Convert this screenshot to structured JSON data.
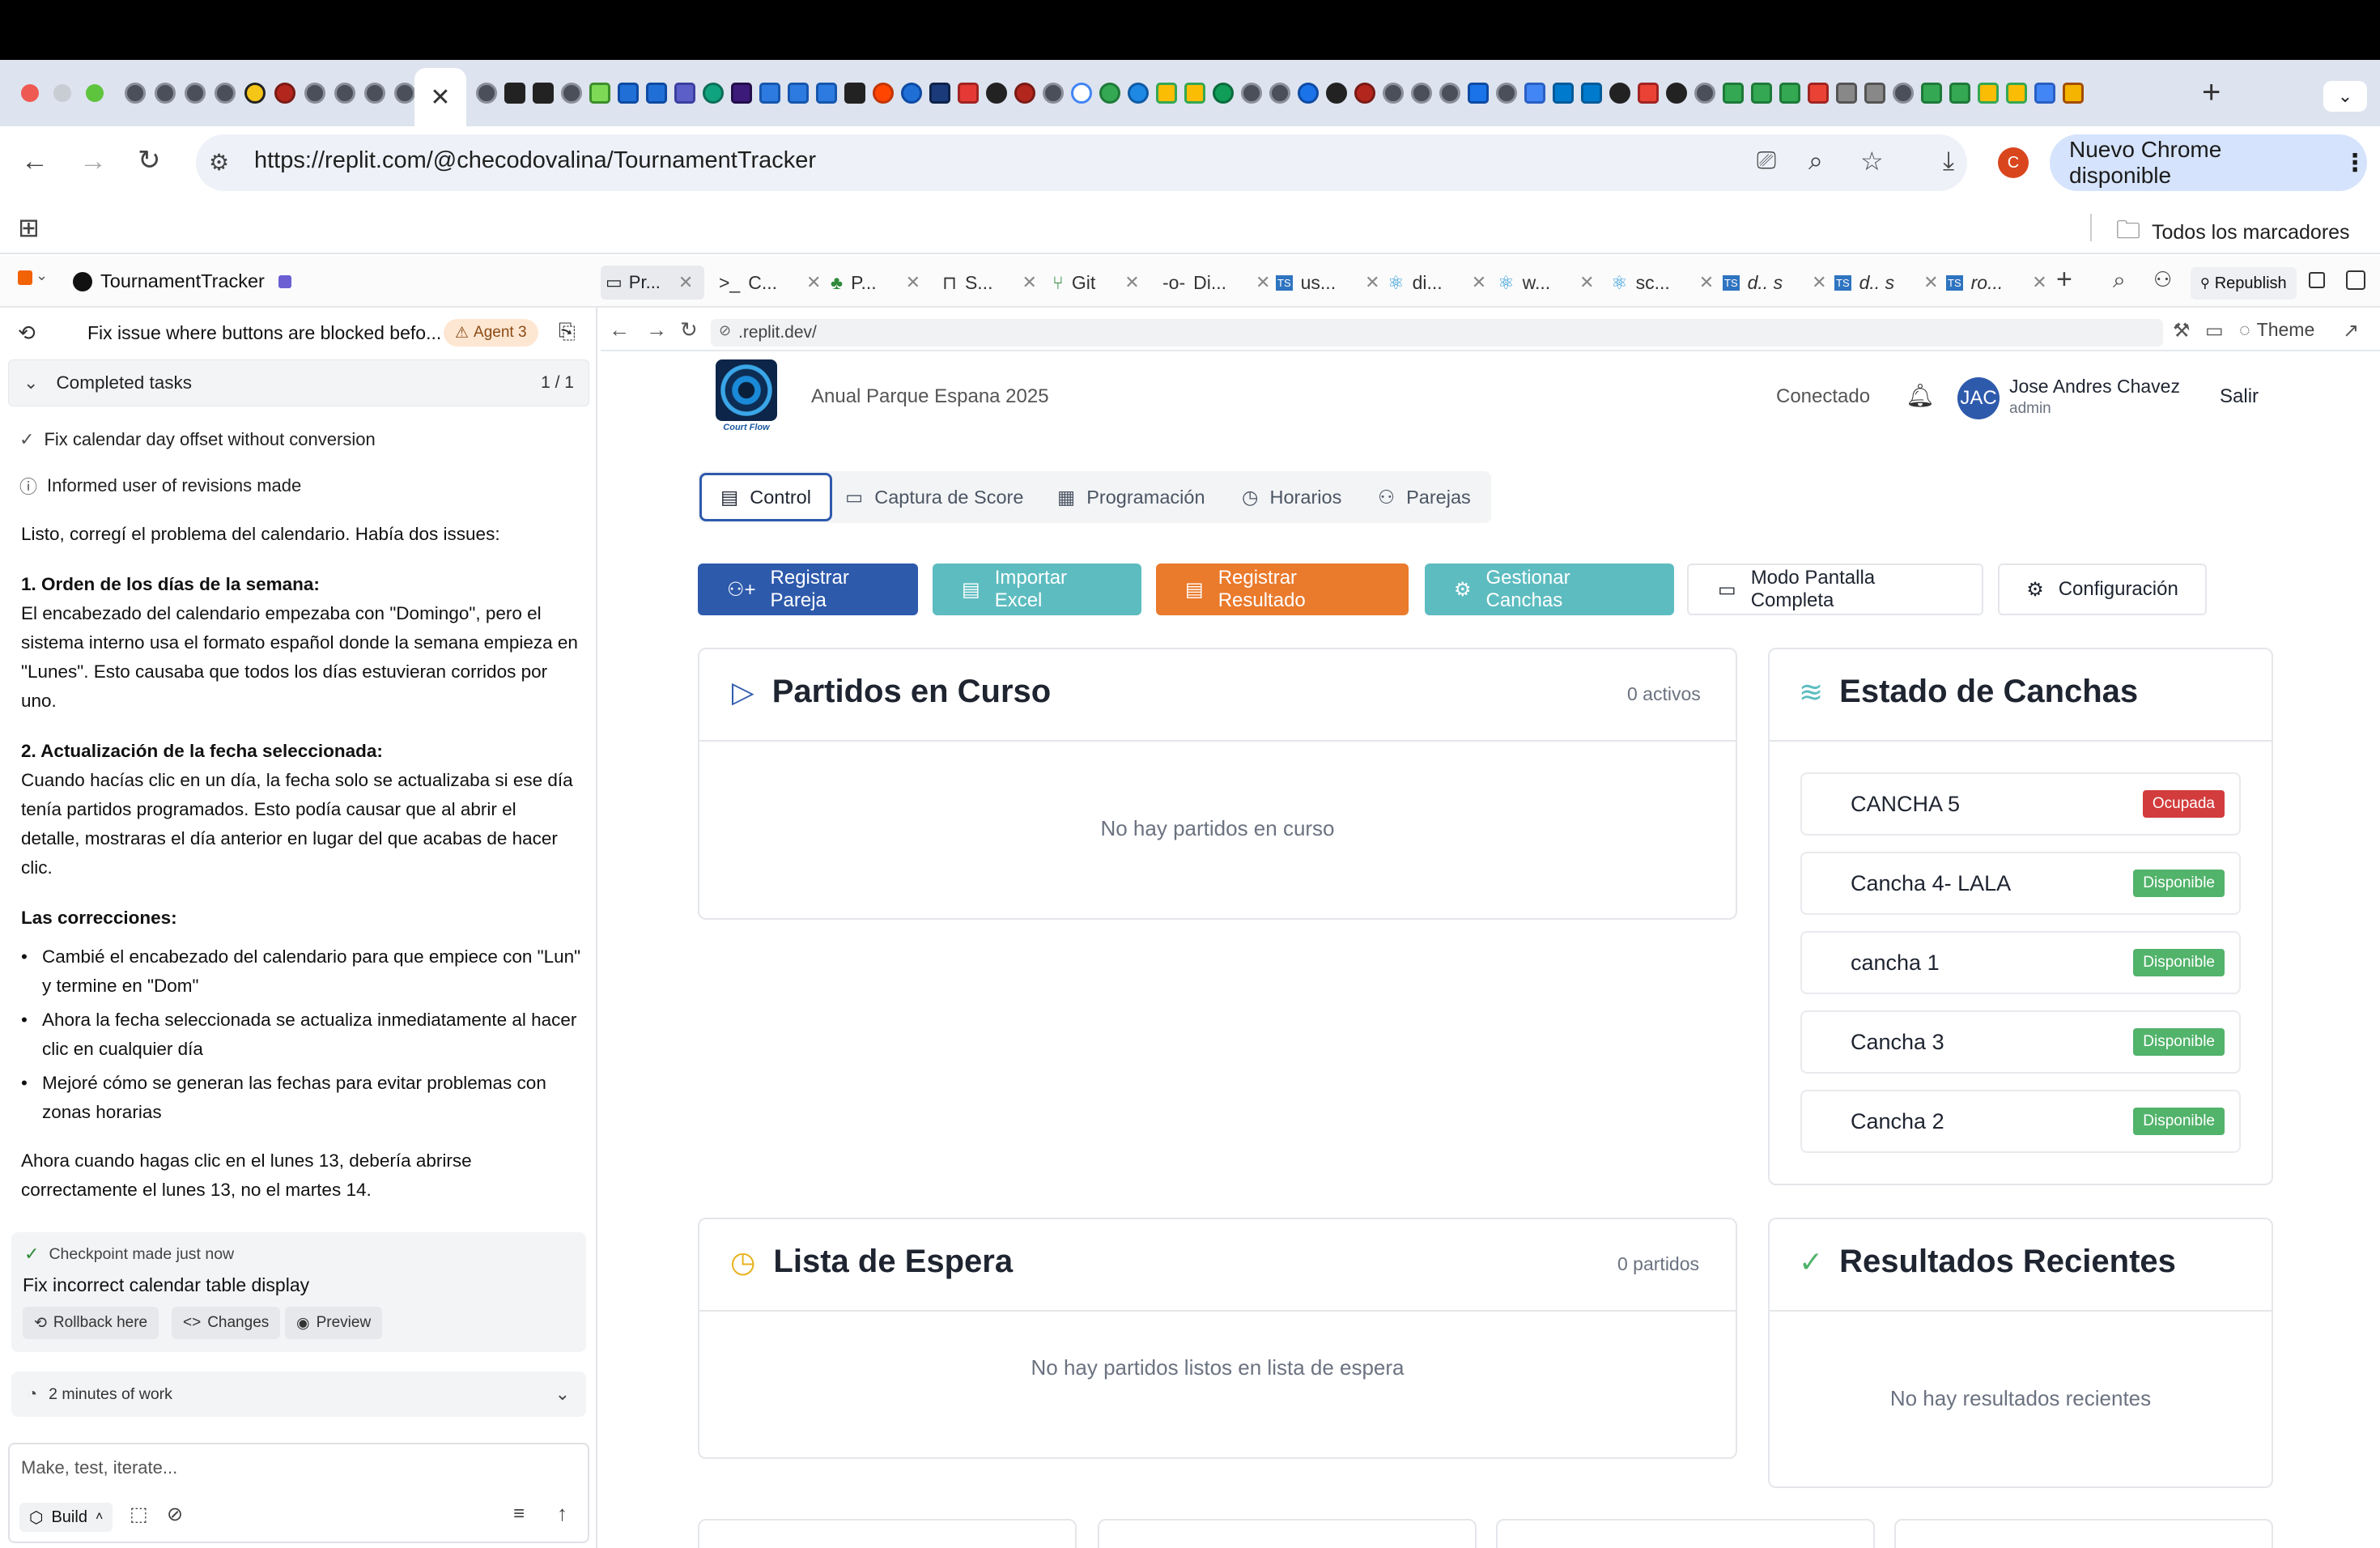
{
  "browser": {
    "url": "https://replit.com/@checodovalina/TournamentTracker",
    "update_label": "Nuevo Chrome disponible",
    "profile_initial": "C",
    "bookmarks_label": "Todos los marcadores"
  },
  "replit": {
    "project_name": "TournamentTracker",
    "tabs": [
      {
        "label": "Pr...",
        "icon": "preview-icon"
      },
      {
        "label": "C...",
        "icon": "terminal-icon"
      },
      {
        "label": "P...",
        "icon": "tree-icon"
      },
      {
        "label": "S...",
        "icon": "lock-icon"
      },
      {
        "label": "Git",
        "icon": "git-icon"
      },
      {
        "label": "Di...",
        "icon": "commit-icon"
      },
      {
        "label": "us...",
        "icon": "ts-icon"
      },
      {
        "label": "di...",
        "icon": "react-icon"
      },
      {
        "label": "w...",
        "icon": "react-icon"
      },
      {
        "label": "sc...",
        "icon": "react-icon"
      },
      {
        "label": "d.. s",
        "icon": "ts-icon"
      },
      {
        "label": "d.. s",
        "icon": "ts-icon"
      },
      {
        "label": "ro...",
        "icon": "ts-icon"
      }
    ],
    "republish_label": "Republish",
    "preview_url": ".replit.dev/",
    "theme_label": "Theme"
  },
  "chat": {
    "thread_title": "Fix issue where buttons are blocked befo...",
    "agent_badge": "Agent 3",
    "completed_tasks_label": "Completed tasks",
    "completed_tasks_count": "1 / 1",
    "task_1": "Fix calendar day offset without conversion",
    "task_2": "Informed user of revisions made",
    "intro": "Listo, corregí el problema del calendario. Había dos issues:",
    "section_1_title": "1. Orden de los días de la semana:",
    "section_1_lines": [
      "El encabezado del calendario empezaba con \"Domingo\", pero el",
      "sistema interno usa el formato español donde la semana empieza en",
      "\"Lunes\". Esto causaba que todos los días estuvieran corridos por",
      "uno."
    ],
    "section_2_title": "2. Actualización de la fecha seleccionada:",
    "section_2_lines": [
      "Cuando hacías clic en un día, la fecha solo se actualizaba si ese día",
      "tenía partidos programados. Esto podía causar que al abrir el",
      "detalle, mostraras el día anterior en lugar del que acabas de hacer",
      "clic."
    ],
    "fixes_title": "Las correcciones:",
    "fix_1_lines": [
      "Cambié el encabezado del calendario para que empiece con \"Lun\"",
      "y termine en \"Dom\""
    ],
    "fix_2_lines": [
      "Ahora la fecha seleccionada se actualiza inmediatamente al hacer",
      "clic en cualquier día"
    ],
    "fix_3_lines": [
      "Mejoré cómo se generan las fechas para evitar problemas con",
      "zonas horarias"
    ],
    "closing_lines": [
      "Ahora cuando hagas clic en el lunes 13, debería abrirse",
      "correctamente el lunes 13, no el martes 14."
    ],
    "checkpoint_label": "Checkpoint made just now",
    "checkpoint_title": "Fix incorrect calendar table display",
    "rollback_label": "Rollback here",
    "changes_label": "Changes",
    "preview_label": "Preview",
    "work_time": "2 minutes of work",
    "input_placeholder": "Make, test, iterate...",
    "build_label": "Build"
  },
  "app": {
    "logo_text": "Court Flow",
    "tournament_name": "Anual Parque Espana 2025",
    "connection_status": "Conectado",
    "user_initials": "JAC",
    "user_name": "Jose Andres Chavez",
    "user_role": "admin",
    "logout_label": "Salir",
    "nav_tabs": [
      "Control",
      "Captura de Score",
      "Programación",
      "Horarios",
      "Parejas"
    ],
    "actions": {
      "register_pair": "Registrar Pareja",
      "import_excel": "Importar Excel",
      "register_result": "Registrar Resultado",
      "manage_courts": "Gestionar Canchas",
      "fullscreen": "Modo Pantalla Completa",
      "settings": "Configuración"
    },
    "colors": {
      "primary": "#2e5aac",
      "teal": "#5dbcc0",
      "orange": "#ea7a2c",
      "green": "#52b36b",
      "red": "#d23c3c"
    },
    "matches_in_progress": {
      "title": "Partidos en Curso",
      "count": "0 activos",
      "empty": "No hay partidos en curso"
    },
    "court_status": {
      "title": "Estado de Canchas",
      "courts": [
        {
          "name": "CANCHA 5",
          "status": "Ocupada"
        },
        {
          "name": "Cancha 4- LALA",
          "status": "Disponible"
        },
        {
          "name": "cancha 1",
          "status": "Disponible"
        },
        {
          "name": "Cancha 3",
          "status": "Disponible"
        },
        {
          "name": "Cancha 2",
          "status": "Disponible"
        }
      ]
    },
    "waiting_list": {
      "title": "Lista de Espera",
      "count": "0 partidos",
      "empty": "No hay partidos listos en lista de espera"
    },
    "recent_results": {
      "title": "Resultados Recientes",
      "empty": "No hay resultados recientes"
    }
  }
}
